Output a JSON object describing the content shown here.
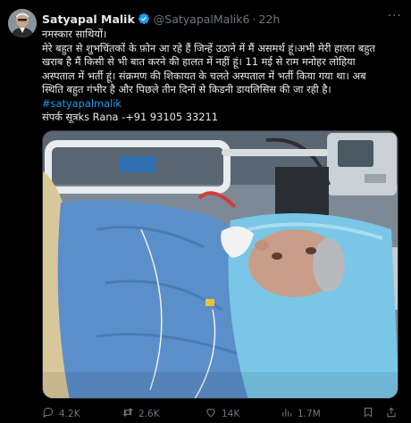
{
  "author": {
    "name": "Satyapal Malik",
    "handle": "@SatyapalMalik6",
    "separator": "·",
    "time": "22h"
  },
  "tweet": {
    "lines": [
      "नमस्कार साथियों।",
      "मेरे बहुत से शुभचिंतकों के फ़ोन आ रहे हैं जिन्हें उठाने में मैं असमर्थ हूं।अभी मेरी हालत बहुत",
      "खराब है मैं किसी से भी बात करने की हालत में नहीं हूं। 11 मई से राम मनोहर लोहिया",
      "अस्पताल में भर्ती हूं। संक्रमण की शिकायत के चलते अस्पताल में भर्ती किया गया था। अब",
      "स्थिति बहुत गंभीर है और पिछले तीन दिनों से किडनी डायलिसिस की जा रही है।"
    ],
    "hashtag": "#satyapalmalik",
    "contact": "संपर्क सूत्रks Rana -+91 93105 33211"
  },
  "metrics": {
    "replies": "4.2K",
    "reposts": "2.6K",
    "likes": "14K",
    "views": "1.7M"
  },
  "colors": {
    "background": "#000000",
    "text": "#e7e9ea",
    "muted": "#71767b",
    "link": "#1d9bf0",
    "verified": "#1d9bf0"
  },
  "icons": [
    "verified-badge-icon",
    "more-options-icon",
    "reply-icon",
    "repost-icon",
    "like-icon",
    "views-icon",
    "bookmark-icon",
    "share-icon"
  ]
}
